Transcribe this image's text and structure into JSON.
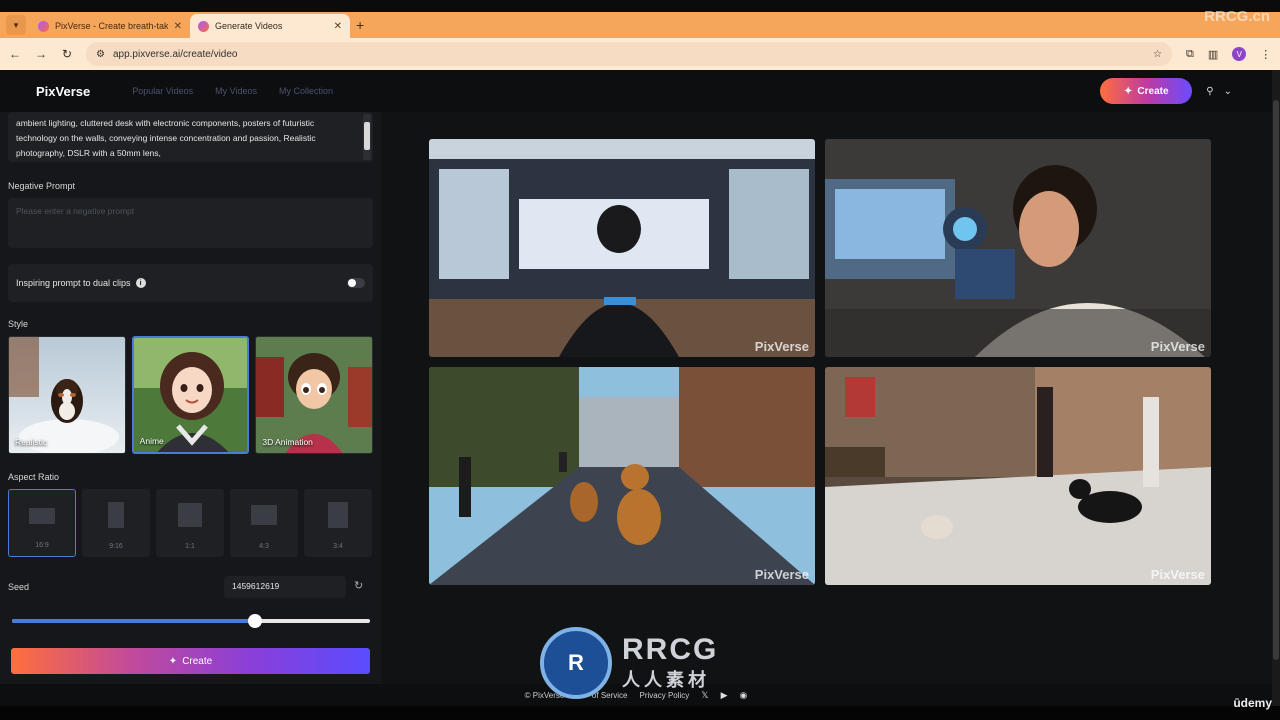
{
  "browser": {
    "tabs": [
      {
        "title": "PixVerse - Create breath-taking",
        "active": false
      },
      {
        "title": "Generate Videos",
        "active": true
      }
    ],
    "new_tab": "+",
    "url": "app.pixverse.ai/create/video",
    "profile_initial": "V"
  },
  "header": {
    "logo": "PixVerse",
    "nav": [
      "Popular Videos",
      "My Videos",
      "My Collection"
    ],
    "create_label": "Create"
  },
  "left": {
    "prompt_text": "ambient lighting, cluttered desk with electronic components, posters of futuristic technology on the walls, conveying intense concentration and passion, Realistic photography, DSLR with a 50mm lens,",
    "negative_label": "Negative Prompt",
    "negative_placeholder": "Please enter a negative prompt",
    "dual_label": "Inspiring prompt to dual clips",
    "style_label": "Style",
    "styles": [
      {
        "name": "Realistic",
        "selected": false
      },
      {
        "name": "Anime",
        "selected": true
      },
      {
        "name": "3D Animation",
        "selected": false
      }
    ],
    "aspect_label": "Aspect Ratio",
    "aspects": [
      {
        "ratio": "16:9",
        "selected": true
      },
      {
        "ratio": "9:16",
        "selected": false
      },
      {
        "ratio": "1:1",
        "selected": false
      },
      {
        "ratio": "4:3",
        "selected": false
      },
      {
        "ratio": "3:4",
        "selected": false
      }
    ],
    "seed_label": "Seed",
    "seed_value": "1459612619",
    "slider_level_percent": 68,
    "create_label": "Create"
  },
  "gallery": {
    "watermark": "PixVerse",
    "videos": 4
  },
  "footer": {
    "copyright": "© PixVerse 202",
    "terms": "of Service",
    "privacy": "Privacy Policy"
  },
  "overlay": {
    "brand_a": "RRCG",
    "brand_b": "人人素材",
    "corner": "RRCG.cn",
    "udemy": "ūdemy"
  },
  "colors": {
    "accent_blue": "#4a7bd6",
    "tab_orange": "#f5a65b",
    "gradient_start": "#ff6f3c",
    "gradient_end": "#5a4cff"
  }
}
